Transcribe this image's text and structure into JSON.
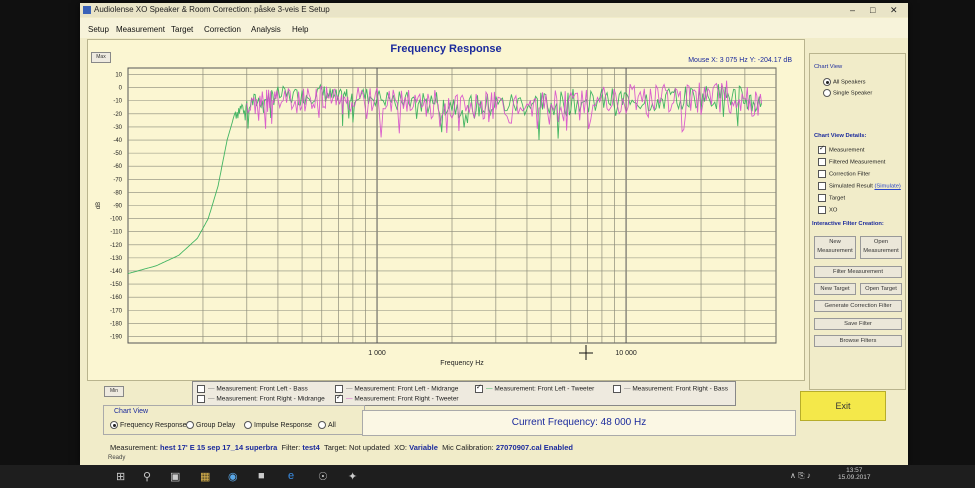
{
  "window": {
    "title": "Audiolense XO Speaker & Room Correction: påske 3-veis E Setup"
  },
  "menu": [
    "Setup",
    "Measurement",
    "Target",
    "Correction",
    "Analysis",
    "Help"
  ],
  "chart": {
    "title": "Frequency Response",
    "mouse_readout": "Mouse X: 3 075 Hz   Y: -204.17 dB",
    "max_label": "Max",
    "min_label": "Min"
  },
  "chart_data": {
    "type": "line",
    "title": "Frequency Response",
    "xlabel": "Frequency Hz",
    "ylabel": "dB",
    "x_scale": "log",
    "xlim": [
      100,
      40000
    ],
    "ylim": [
      -195,
      15
    ],
    "x_tick_labels": [
      "1 000",
      "10 000"
    ],
    "x_ticks": [
      1000,
      10000
    ],
    "y_ticks": [
      10,
      0,
      -10,
      -20,
      -30,
      -40,
      -50,
      -60,
      -70,
      -80,
      -90,
      -100,
      -110,
      -120,
      -130,
      -140,
      -150,
      -160,
      -170,
      -180,
      -190
    ],
    "grid": true,
    "series": [
      {
        "name": "Measurement: Front Left - Tweeter",
        "color": "#2fae57",
        "x": [
          100,
          130,
          160,
          190,
          210,
          230,
          250,
          270,
          300,
          350,
          400,
          500,
          600,
          700,
          800,
          1000,
          1300,
          1600,
          2000,
          2500,
          3000,
          4000,
          5000,
          6000,
          8000,
          10000,
          13000,
          16000,
          20000,
          25000,
          30000,
          35000
        ],
        "y": [
          -142,
          -136,
          -128,
          -115,
          -100,
          -75,
          -40,
          -18,
          -12,
          -8,
          -5,
          -6,
          -3,
          -8,
          -4,
          -7,
          -9,
          -10,
          -11,
          -14,
          -12,
          -11,
          -12,
          -10,
          -9,
          -8,
          -8,
          -7,
          -6,
          -5,
          -8,
          -12
        ]
      },
      {
        "name": "Measurement: Front Right - Tweeter",
        "color": "#d64fcb",
        "x": [
          300,
          350,
          400,
          500,
          600,
          700,
          800,
          1000,
          1300,
          1600,
          2000,
          2500,
          3000,
          4000,
          5000,
          6000,
          8000,
          10000,
          13000,
          16000,
          20000,
          25000,
          30000,
          35000
        ],
        "y": [
          -15,
          -10,
          -8,
          -9,
          -7,
          -10,
          -8,
          -9,
          -10,
          -12,
          -13,
          -16,
          -14,
          -13,
          -14,
          -12,
          -11,
          -9,
          -9,
          -8,
          -7,
          -6,
          -8,
          -12
        ]
      }
    ]
  },
  "legend": {
    "items": [
      {
        "label": "Measurement: Front Left - Bass",
        "checked": false
      },
      {
        "label": "Measurement: Front Left - Midrange",
        "checked": false
      },
      {
        "label": "Measurement: Front Left - Tweeter",
        "checked": true
      },
      {
        "label": "Measurement: Front Right - Bass",
        "checked": false
      },
      {
        "label": "Measurement: Front Right - Midrange",
        "checked": false
      },
      {
        "label": "Measurement: Front Right - Tweeter",
        "checked": true
      }
    ]
  },
  "chart_view_group": {
    "label": "Chart View",
    "options": [
      "Frequency Response",
      "Group Delay",
      "Impulse Response",
      "All"
    ],
    "selected": "Frequency Response"
  },
  "current_frequency": "Current Frequency:  48 000 Hz",
  "exit_label": "Exit",
  "right_panel": {
    "chart_view_label": "Chart View",
    "all_speakers": "All Speakers",
    "single_speaker": "Single Speaker",
    "details_label": "Chart View Details:",
    "measurement": "Measurement",
    "filtered_measurement": "Filtered Measurement",
    "correction_filter": "Correction Filter",
    "simulated_result": "Simulated Result",
    "simulated_link": "(Simulate)",
    "target": "Target",
    "xo": "XO",
    "interactive_label": "Interactive Filter Creation:",
    "new_measurement": "New Measurement",
    "open_measurement": "Open Measurement",
    "filter_measurement": "Filter Measurement",
    "new_target": "New Target",
    "open_target": "Open Target",
    "generate_correction": "Generate Correction Filter",
    "save_filter": "Save Filter",
    "browse_filters": "Browse Filters"
  },
  "status": {
    "measurement_label": "Measurement:",
    "measurement_value": "hest 17' E 15 sep 17_14 superbra",
    "filter_label": "Filter:",
    "filter_value": "test4",
    "target_label": "Target:",
    "target_value": "Not updated",
    "xo_label": "XO:",
    "xo_value": "Variable",
    "mic_label": "Mic Calibration:",
    "mic_value": "27070907.cal Enabled",
    "ready": "Ready"
  },
  "taskbar": {
    "time": "13:57",
    "date": "15.09.2017"
  }
}
